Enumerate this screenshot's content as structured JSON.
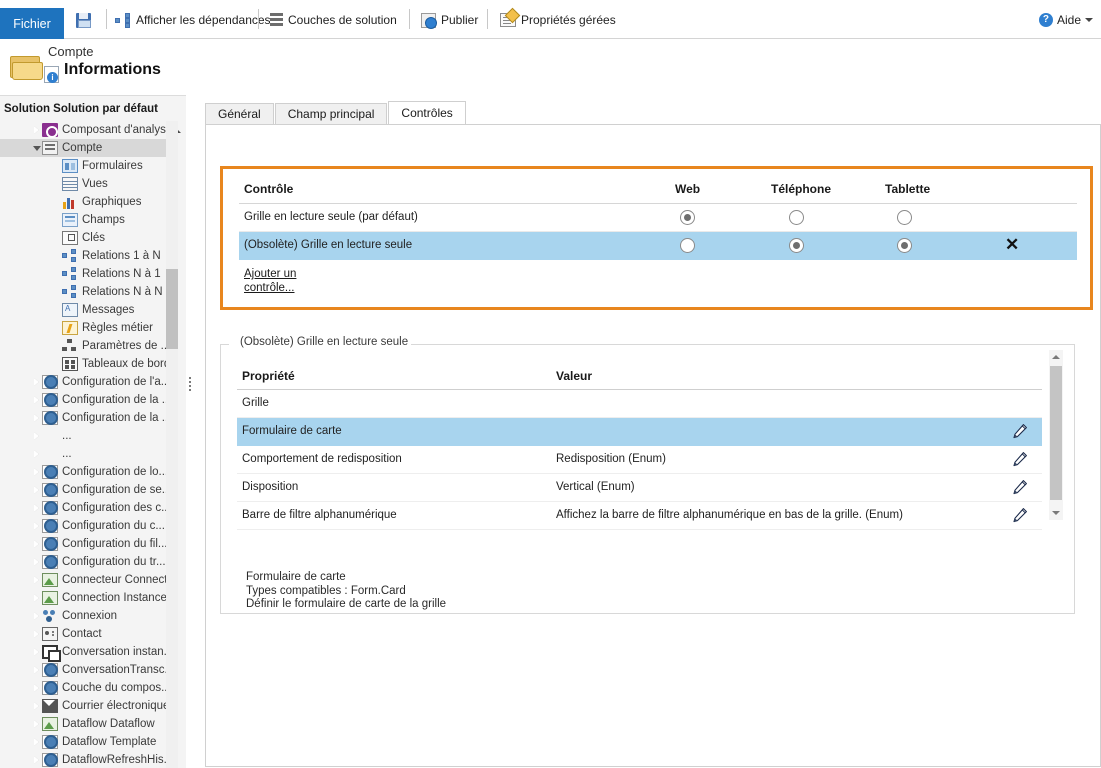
{
  "toolbar": {
    "file_label": "Fichier",
    "items": [
      {
        "label": "",
        "icon": "save-icon"
      },
      {
        "label": "Afficher les dépendances",
        "icon": "dependencies-icon"
      },
      {
        "label": "Couches de solution",
        "icon": "solution-layers-icon"
      },
      {
        "label": "Publier",
        "icon": "publish-icon"
      },
      {
        "label": "Propriétés gérées",
        "icon": "managed-properties-icon"
      }
    ],
    "help_label": "Aide"
  },
  "sidebar": {
    "entity_kind": "Compte",
    "entity_section": "Informations",
    "solution_label": "Solution Solution par défaut",
    "tree": [
      {
        "label": "Composant d'analyse",
        "indent": 1,
        "arrow": "closed",
        "icon": "analysis-component-icon",
        "selected": false
      },
      {
        "label": "Compte",
        "indent": 1,
        "arrow": "open",
        "icon": "entity-icon",
        "selected": true
      },
      {
        "label": "Formulaires",
        "indent": 2,
        "arrow": "none",
        "icon": "forms-icon",
        "selected": false
      },
      {
        "label": "Vues",
        "indent": 2,
        "arrow": "none",
        "icon": "views-icon",
        "selected": false
      },
      {
        "label": "Graphiques",
        "indent": 2,
        "arrow": "none",
        "icon": "charts-icon",
        "selected": false
      },
      {
        "label": "Champs",
        "indent": 2,
        "arrow": "none",
        "icon": "fields-icon",
        "selected": false
      },
      {
        "label": "Clés",
        "indent": 2,
        "arrow": "none",
        "icon": "keys-icon",
        "selected": false
      },
      {
        "label": "Relations 1 à N",
        "indent": 2,
        "arrow": "none",
        "icon": "relationship-1n-icon",
        "selected": false
      },
      {
        "label": "Relations N à 1",
        "indent": 2,
        "arrow": "none",
        "icon": "relationship-n1-icon",
        "selected": false
      },
      {
        "label": "Relations N à N",
        "indent": 2,
        "arrow": "none",
        "icon": "relationship-nn-icon",
        "selected": false
      },
      {
        "label": "Messages",
        "indent": 2,
        "arrow": "none",
        "icon": "messages-icon",
        "selected": false
      },
      {
        "label": "Règles métier",
        "indent": 2,
        "arrow": "none",
        "icon": "business-rules-icon",
        "selected": false
      },
      {
        "label": "Paramètres de ...",
        "indent": 2,
        "arrow": "none",
        "icon": "parameters-icon",
        "selected": false
      },
      {
        "label": "Tableaux de bord",
        "indent": 2,
        "arrow": "none",
        "icon": "dashboards-icon",
        "selected": false
      },
      {
        "label": "Configuration de l'a...",
        "indent": 1,
        "arrow": "closed",
        "icon": "gear-icon",
        "selected": false
      },
      {
        "label": "Configuration de la ...",
        "indent": 1,
        "arrow": "closed",
        "icon": "gear-icon",
        "selected": false
      },
      {
        "label": "Configuration de la ...",
        "indent": 1,
        "arrow": "closed",
        "icon": "gear-icon",
        "selected": false
      },
      {
        "label": "...",
        "indent": 1,
        "arrow": "closed",
        "icon": "none-icon",
        "selected": false
      },
      {
        "label": "...",
        "indent": 1,
        "arrow": "closed",
        "icon": "none-icon",
        "selected": false
      },
      {
        "label": "Configuration de lo...",
        "indent": 1,
        "arrow": "closed",
        "icon": "gear-icon",
        "selected": false
      },
      {
        "label": "Configuration de se...",
        "indent": 1,
        "arrow": "closed",
        "icon": "gear-icon",
        "selected": false
      },
      {
        "label": "Configuration des c...",
        "indent": 1,
        "arrow": "closed",
        "icon": "gear-icon",
        "selected": false
      },
      {
        "label": "Configuration du c...",
        "indent": 1,
        "arrow": "closed",
        "icon": "gear-icon",
        "selected": false
      },
      {
        "label": "Configuration du fil...",
        "indent": 1,
        "arrow": "closed",
        "icon": "gear-icon",
        "selected": false
      },
      {
        "label": "Configuration du tr...",
        "indent": 1,
        "arrow": "closed",
        "icon": "gear-icon",
        "selected": false
      },
      {
        "label": "Connecteur Connect...",
        "indent": 1,
        "arrow": "closed",
        "icon": "image-icon",
        "selected": false
      },
      {
        "label": "Connection Instance...",
        "indent": 1,
        "arrow": "closed",
        "icon": "image-icon",
        "selected": false
      },
      {
        "label": "Connexion",
        "indent": 1,
        "arrow": "closed",
        "icon": "connection-icon",
        "selected": false
      },
      {
        "label": "Contact",
        "indent": 1,
        "arrow": "closed",
        "icon": "contact-icon",
        "selected": false
      },
      {
        "label": "Conversation instan...",
        "indent": 1,
        "arrow": "closed",
        "icon": "chat-icon",
        "selected": false
      },
      {
        "label": "ConversationTransc...",
        "indent": 1,
        "arrow": "closed",
        "icon": "gear-icon",
        "selected": false
      },
      {
        "label": "Couche du compos...",
        "indent": 1,
        "arrow": "closed",
        "icon": "gear-icon",
        "selected": false
      },
      {
        "label": "Courrier électronique",
        "indent": 1,
        "arrow": "closed",
        "icon": "mail-icon",
        "selected": false
      },
      {
        "label": "Dataflow Dataflow",
        "indent": 1,
        "arrow": "closed",
        "icon": "image-icon",
        "selected": false
      },
      {
        "label": "Dataflow Template",
        "indent": 1,
        "arrow": "closed",
        "icon": "gear-icon",
        "selected": false
      },
      {
        "label": "DataflowRefreshHis...",
        "indent": 1,
        "arrow": "closed",
        "icon": "gear-icon",
        "selected": false
      }
    ]
  },
  "main": {
    "tabs": [
      {
        "label": "Général",
        "active": false
      },
      {
        "label": "Champ principal",
        "active": false
      },
      {
        "label": "Contrôles",
        "active": true
      }
    ],
    "controls_section": {
      "highlight_color": "#e8861e",
      "headers": {
        "control": "Contrôle",
        "web": "Web",
        "phone": "Téléphone",
        "tablet": "Tablette"
      },
      "rows": [
        {
          "name": "Grille en lecture seule (par défaut)",
          "web": true,
          "phone": false,
          "tablet": false,
          "selected": false,
          "removable": false
        },
        {
          "name": "(Obsolète) Grille en lecture seule",
          "web": false,
          "phone": true,
          "tablet": true,
          "selected": true,
          "removable": true,
          "remove_label": "✕"
        }
      ],
      "add_control_line1": "Ajouter un",
      "add_control_line2": "contrôle..."
    },
    "properties_section": {
      "legend": "(Obsolète) Grille en lecture seule",
      "headers": {
        "property": "Propriété",
        "value": "Valeur"
      },
      "rows": [
        {
          "property": "Grille",
          "value": "",
          "selected": false,
          "editable": false
        },
        {
          "property": "Formulaire de carte",
          "value": "",
          "selected": true,
          "editable": true
        },
        {
          "property": "Comportement de redisposition",
          "value": "Redisposition (Enum)",
          "selected": false,
          "editable": true
        },
        {
          "property": "Disposition",
          "value": "Vertical (Enum)",
          "selected": false,
          "editable": true
        },
        {
          "property": "Barre de filtre alphanumérique",
          "value": "Affichez la barre de filtre alphanumérique en bas de la grille. (Enum)",
          "selected": false,
          "editable": true
        }
      ]
    },
    "description": {
      "title": "Formulaire de carte",
      "types": "Types compatibles : Form.Card",
      "help": "Définir le formulaire de carte de la grille"
    }
  }
}
